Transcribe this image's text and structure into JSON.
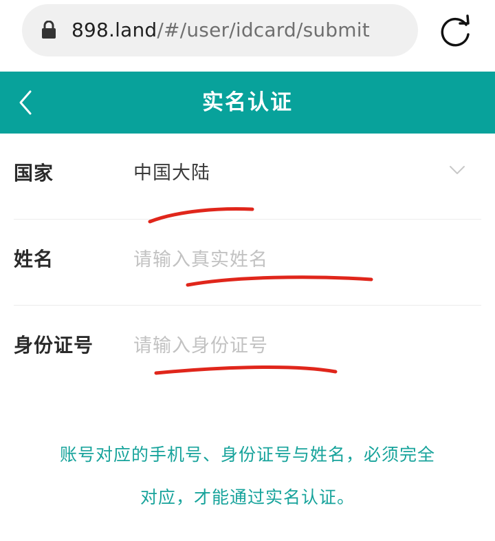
{
  "browser": {
    "url_host": "898.land",
    "url_path": "/#/user/idcard/submit"
  },
  "header": {
    "title": "实名认证"
  },
  "form": {
    "country": {
      "label": "国家",
      "value": "中国大陆"
    },
    "name": {
      "label": "姓名",
      "placeholder": "请输入真实姓名",
      "value": ""
    },
    "id_number": {
      "label": "身份证号",
      "placeholder": "请输入身份证号",
      "value": ""
    }
  },
  "notice": {
    "line1": "账号对应的手机号、身份证号与姓名，必须完全",
    "line2": "对应，才能通过实名认证。"
  },
  "icons": {
    "lock": "lock-icon",
    "reload": "reload-icon",
    "back": "back-arrow-icon",
    "chevron": "chevron-down-icon"
  },
  "colors": {
    "header_bg": "#08a29b",
    "accent_text": "#17a39b",
    "annotation_stroke": "#e0261b"
  }
}
